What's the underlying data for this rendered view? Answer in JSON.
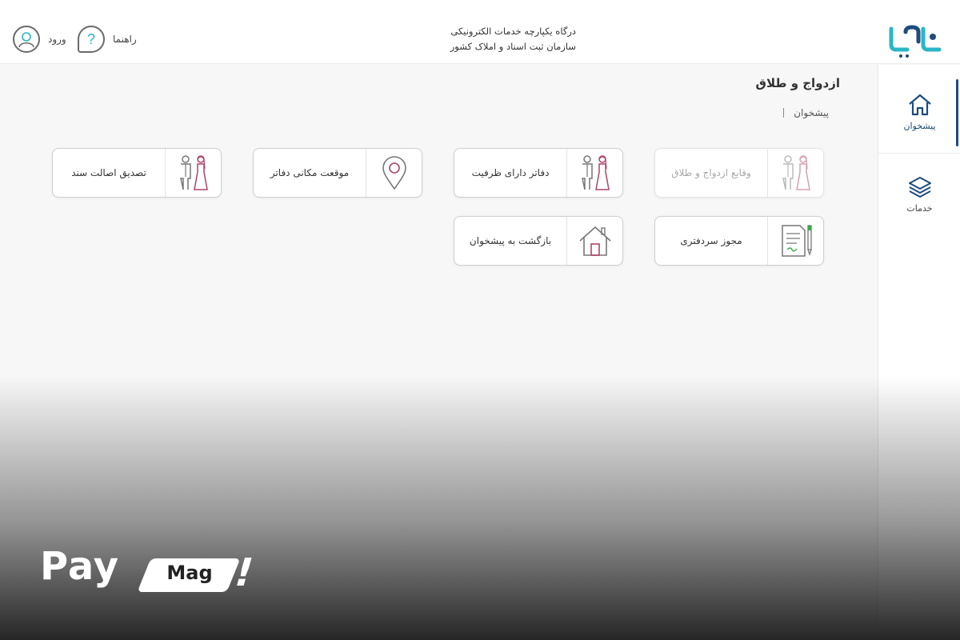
{
  "header": {
    "login_label": "ورود",
    "help_label": "راهنما",
    "help_glyph": "?",
    "portal_line1": "درگاه یکپارچه خدمات الکترونیکی",
    "portal_line2": "سازمان ثبت اسناد و املاک کشور",
    "logo_icon": "sabt-man-logo"
  },
  "sidebar": {
    "items": [
      {
        "label": "پیشخوان",
        "icon": "home-icon",
        "active": true
      },
      {
        "label": "خدمات",
        "icon": "layers-icon",
        "active": false
      }
    ]
  },
  "main": {
    "title": "ازدواج و طلاق",
    "breadcrumb": "پیشخوان",
    "cards": [
      {
        "label": "وقایع ازدواج و طلاق",
        "icon": "couple-icon",
        "disabled": true
      },
      {
        "label": "دفاتر دارای ظرفیت",
        "icon": "couple-icon",
        "disabled": false
      },
      {
        "label": "موقعت مکانی دفاتر",
        "icon": "location-pin-icon",
        "disabled": false
      },
      {
        "label": "تصدیق اصالت سند",
        "icon": "couple-icon",
        "disabled": false
      },
      {
        "label": "مجوز سردفتری",
        "icon": "document-pen-icon",
        "disabled": false
      },
      {
        "label": "بازگشت به پیشخوان",
        "icon": "house-icon",
        "disabled": false
      }
    ]
  },
  "watermark": {
    "pay": "Pay",
    "mag": "Mag",
    "excl": "!"
  },
  "colors": {
    "accent": "#1d4c7d",
    "teal": "#2bb6c8",
    "bride": "#b0426a"
  }
}
